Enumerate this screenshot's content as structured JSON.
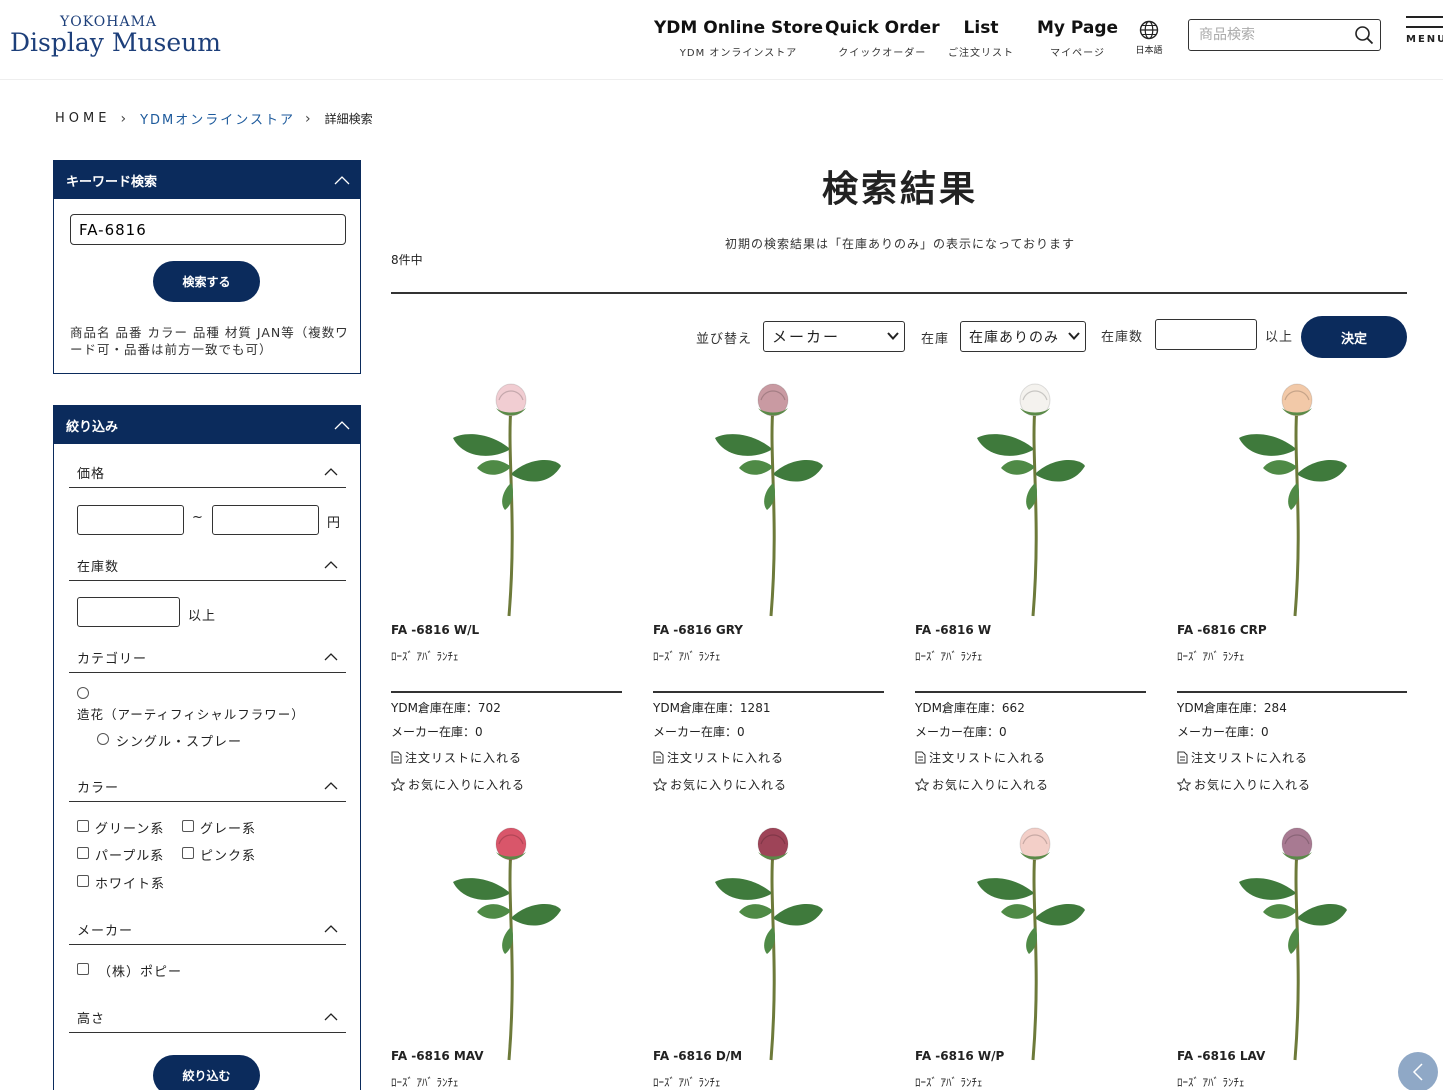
{
  "header": {
    "logo_line1": "YOKOHAMA",
    "logo_line2": "Display Museum",
    "nav": [
      {
        "main": "YDM Online Store",
        "sub": "YDM オンラインストア"
      },
      {
        "main": "Quick Order",
        "sub": "クイックオーダー"
      },
      {
        "main": "List",
        "sub": "ご注文リスト"
      },
      {
        "main": "My Page",
        "sub": "マイページ"
      }
    ],
    "language_label": "日本語",
    "search_placeholder": "商品検索",
    "menu_label": "MENU"
  },
  "breadcrumb": {
    "home": "HOME",
    "store": "YDMオンラインストア",
    "current": "詳細検索"
  },
  "keyword_panel": {
    "title": "キーワード検索",
    "input_value": "FA-6816",
    "search_button": "検索する",
    "note": "商品名 品番 カラー 品種 材質 JAN等（複数ワード可・品番は前方一致でも可）"
  },
  "filter_panel": {
    "title": "絞り込み",
    "price": {
      "title": "価格",
      "tilde": "~",
      "unit": "円"
    },
    "stock": {
      "title": "在庫数",
      "suffix": "以上"
    },
    "category": {
      "title": "カテゴリー",
      "parent": "造花（アーティフィシャルフラワー）",
      "child": "シングル・スプレー"
    },
    "color": {
      "title": "カラー",
      "options": [
        "グリーン系",
        "グレー系",
        "パープル系",
        "ピンク系",
        "ホワイト系"
      ]
    },
    "maker": {
      "title": "メーカー",
      "options": [
        "（株）ポピー"
      ]
    },
    "height": {
      "title": "高さ"
    },
    "apply_button": "絞り込む"
  },
  "main": {
    "title": "検索結果",
    "notice": "初期の検索結果は「在庫ありのみ」の表示になっております",
    "count": "8件中",
    "sort_label": "並び替え",
    "sort_value": "メーカー",
    "stock_label": "在庫",
    "stock_value": "在庫ありのみ",
    "stock_count_label": "在庫数",
    "stock_count_suffix": "以上",
    "decide_button": "決定"
  },
  "product_labels": {
    "add_list": "注文リストに入れる",
    "add_fav": "お気に入りに入れる"
  },
  "products": [
    {
      "code": "FA -6816 W/L",
      "name": "ﾛｰｽﾞ ｱﾊﾞ ﾗﾝﾁｪ",
      "ydm_stock": "YDM倉庫在庫：702",
      "maker_stock": "メーカー在庫：0",
      "color": "#f1cdd2"
    },
    {
      "code": "FA -6816 GRY",
      "name": "ﾛｰｽﾞ ｱﾊﾞ ﾗﾝﾁｪ",
      "ydm_stock": "YDM倉庫在庫：1281",
      "maker_stock": "メーカー在庫：0",
      "color": "#c99aa2"
    },
    {
      "code": "FA -6816 W",
      "name": "ﾛｰｽﾞ ｱﾊﾞ ﾗﾝﾁｪ",
      "ydm_stock": "YDM倉庫在庫：662",
      "maker_stock": "メーカー在庫：0",
      "color": "#f4f2ee"
    },
    {
      "code": "FA -6816 CRP",
      "name": "ﾛｰｽﾞ ｱﾊﾞ ﾗﾝﾁｪ",
      "ydm_stock": "YDM倉庫在庫：284",
      "maker_stock": "メーカー在庫：0",
      "color": "#f2c9a8"
    },
    {
      "code": "FA -6816 MAV",
      "name": "ﾛｰｽﾞ ｱﾊﾞ ﾗﾝﾁｪ",
      "color": "#d9566a"
    },
    {
      "code": "FA -6816 D/M",
      "name": "ﾛｰｽﾞ ｱﾊﾞ ﾗﾝﾁｪ",
      "color": "#9e4458"
    },
    {
      "code": "FA -6816 W/P",
      "name": "ﾛｰｽﾞ ｱﾊﾞ ﾗﾝﾁｪ",
      "color": "#f3cfc8"
    },
    {
      "code": "FA -6816 LAV",
      "name": "ﾛｰｽﾞ ｱﾊﾞ ﾗﾝﾁｪ",
      "color": "#a87a92"
    }
  ],
  "colors": {
    "navy": "#0b2b5c",
    "leaf": "#3f7a3c",
    "stem": "#6d7a3a"
  }
}
